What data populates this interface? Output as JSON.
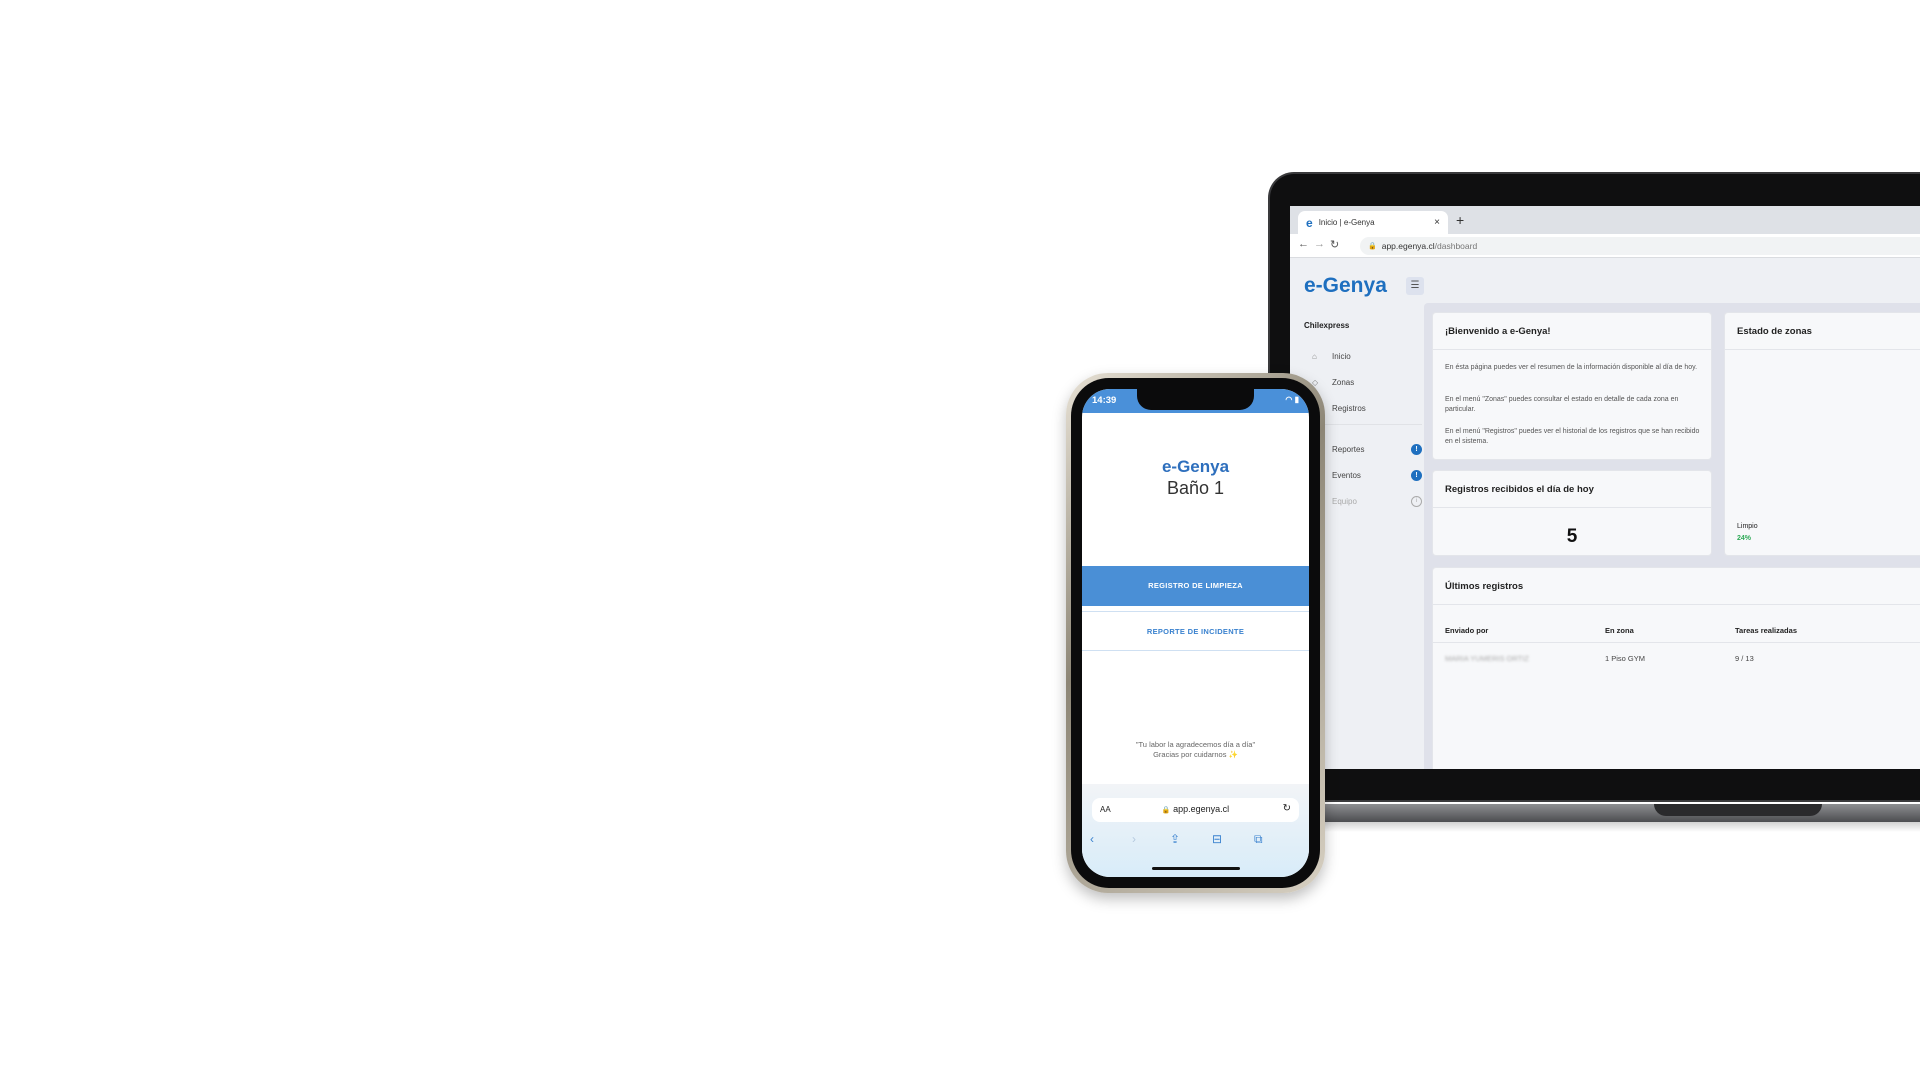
{
  "laptop": {
    "tab_title": "Inicio | e-Genya",
    "tab_favicon": "e",
    "tab_close": "×",
    "new_tab": "+",
    "url_host": "app.egenya.cl",
    "url_path": "/dashboard",
    "app": {
      "logo": "e-Genya",
      "organization": "Chilexpress",
      "sidebar": [
        {
          "label": "Inicio",
          "icon": "home-icon"
        },
        {
          "label": "Zonas",
          "icon": "zones-icon"
        },
        {
          "label": "Registros",
          "icon": "records-icon"
        },
        {
          "label": "Reportes",
          "icon": "reports-icon",
          "badge": "!"
        },
        {
          "label": "Eventos",
          "icon": "events-icon",
          "badge": "!"
        },
        {
          "label": "Equipo",
          "icon": "team-icon",
          "info": "i",
          "disabled": true
        }
      ],
      "welcome": {
        "title": "¡Bienvenido a e-Genya!",
        "paragraphs": [
          "En ésta página puedes ver el resumen de la información disponible al día de hoy.",
          "En el menú \"Zonas\" puedes consultar el estado en detalle de cada zona en particular.",
          "En el menú \"Registros\" puedes ver el historial de los registros que se han recibido en el sistema."
        ]
      },
      "zone_status": {
        "title": "Estado de zonas",
        "label": "Limpio",
        "percent": "24%"
      },
      "today_records": {
        "title": "Registros recibidos el día de hoy",
        "count": "5"
      },
      "last_records": {
        "title": "Últimos registros",
        "columns": [
          "Enviado por",
          "En zona",
          "Tareas realizadas"
        ],
        "rows": [
          [
            "MARIA YUMERIS ORTIZ",
            "1 Piso GYM",
            "9 / 13"
          ]
        ]
      }
    }
  },
  "phone": {
    "time": "14:39",
    "title": "e-Genya",
    "subtitle": "Baño 1",
    "primary_button": "REGISTRO DE LIMPIEZA",
    "secondary_button": "REPORTE DE INCIDENTE",
    "quote_line1": "\"Tu labor la agradecemos día a día\"",
    "quote_line2": "Gracias por cuidarnos ✨",
    "safari_aa": "AA",
    "safari_url": "app.egenya.cl"
  },
  "colors": {
    "brand_blue": "#1e6fbf",
    "phone_button_blue": "#4a8fd6",
    "success_green": "#2eaa57"
  }
}
